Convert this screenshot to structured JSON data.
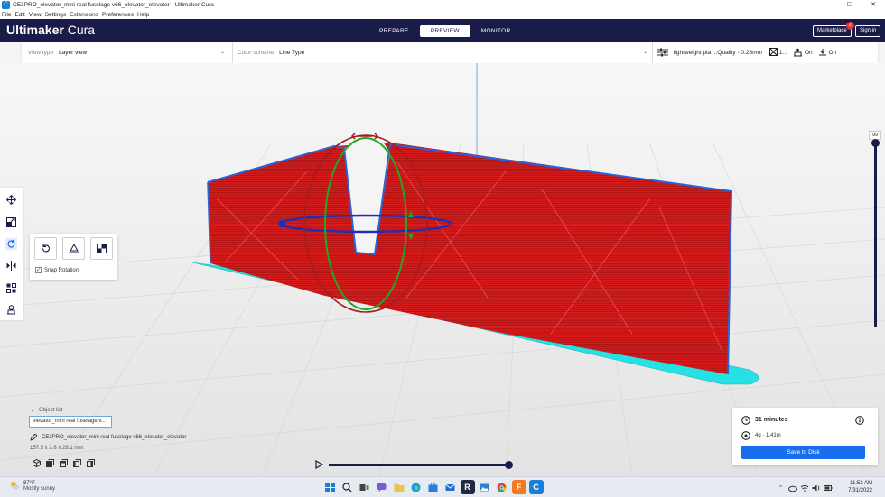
{
  "window": {
    "title": "CE3PRO_elevator_mini real fuselage v66_elevator_elevator - Ultimaker Cura",
    "controls": [
      "–",
      "☐",
      "✕"
    ]
  },
  "menu": [
    "File",
    "Edit",
    "View",
    "Settings",
    "Extensions",
    "Preferences",
    "Help"
  ],
  "header": {
    "brand_bold": "Ultimaker",
    "brand_light": " Cura",
    "stages": [
      "PREPARE",
      "PREVIEW",
      "MONITOR"
    ],
    "active_stage": "PREVIEW",
    "marketplace": "Marketplace",
    "marketplace_badge": "2",
    "signin": "Sign in"
  },
  "toolbar": {
    "view_type_label": "View type",
    "view_type_value": "Layer view",
    "color_scheme_label": "Color scheme",
    "color_scheme_value": "Line Type",
    "profile": "lightweight pla ...Quality - 0.28mm",
    "infill": "1...",
    "support": "On",
    "adhesion": "On"
  },
  "layer_slider": {
    "top_layer": "99",
    "fraction": 1.0
  },
  "rotate_panel": {
    "snap_label": "Snap Rotation",
    "snap_checked": true
  },
  "object_list": {
    "header": "Object list",
    "item": "elevator_mini real fuselage v...",
    "name": "CE3PRO_elevator_mini real fuselage v66_elevator_elevator",
    "dimensions": "157.5 x 2.8 x 28.1 mm"
  },
  "simulation": {
    "fraction": 1.0
  },
  "print": {
    "time": "31 minutes",
    "material": "4g · 1.41m",
    "save": "Save to Disk"
  },
  "taskbar": {
    "temp": "87°F",
    "weather": "Mostly sunny",
    "time": "11:53 AM",
    "date": "7/31/2022"
  },
  "colors": {
    "header": "#191b48",
    "wall": "#d81c1c",
    "outer_wall": "#2a62d8",
    "skirt": "#27e0e4",
    "accent": "#196ef0"
  }
}
